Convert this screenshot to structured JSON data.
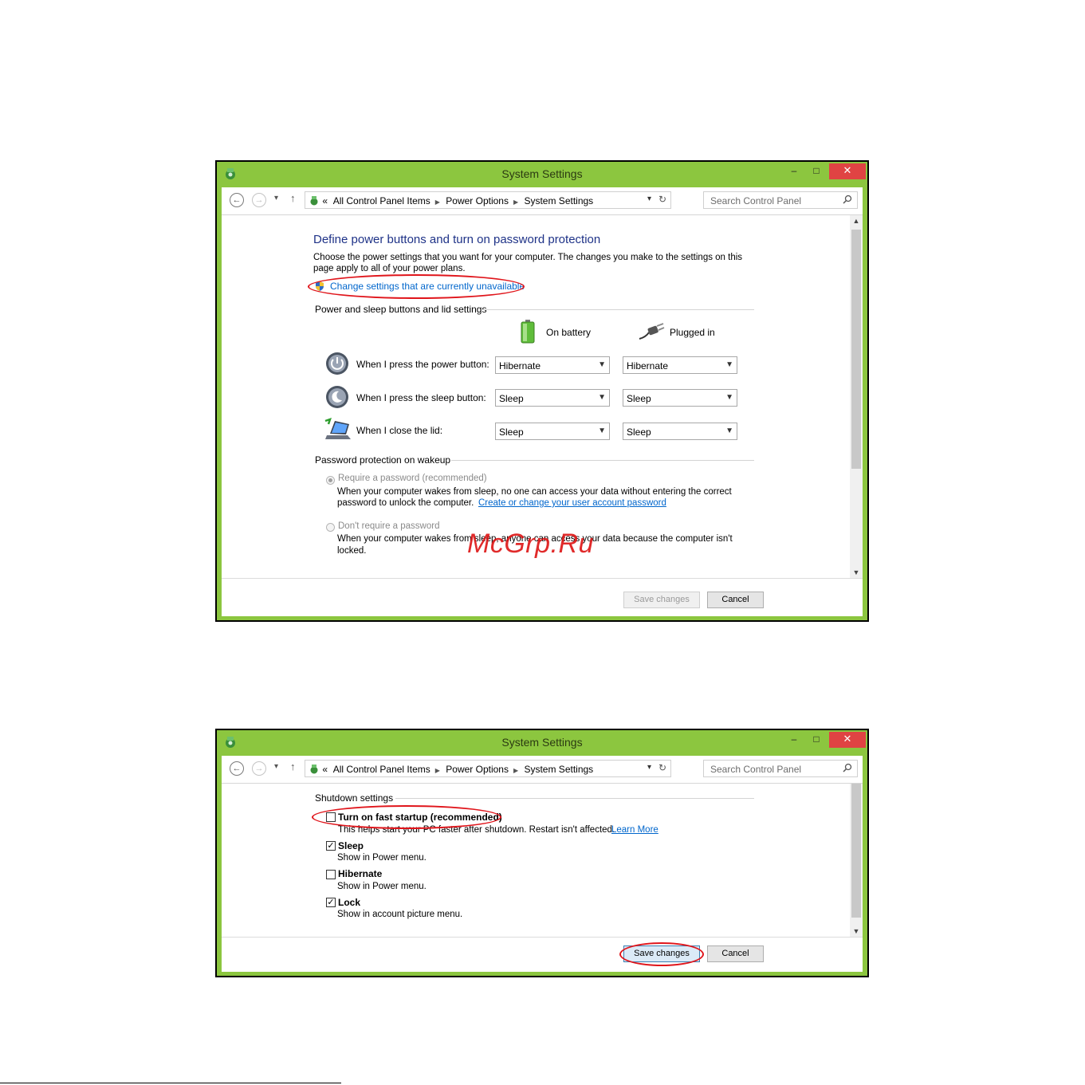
{
  "colors": {
    "frame": "#8cc63f",
    "close": "#e04343",
    "heading": "#1e3287",
    "link": "#0066cc",
    "annotation": "#e0151b"
  },
  "window1": {
    "title": "System Settings",
    "controls": {
      "minimize": "–",
      "maximize": "□",
      "close": "✕"
    },
    "nav": {
      "back": "←",
      "forward": "→",
      "recent": "▾",
      "up": "↑"
    },
    "address": {
      "prefix": "«",
      "crumbs": [
        "All Control Panel Items",
        "Power Options",
        "System Settings"
      ],
      "dropdown": "▾",
      "refresh": "↻"
    },
    "search": {
      "placeholder": "Search Control Panel"
    },
    "heading": "Define power buttons and turn on password protection",
    "intro_line1": "Choose the power settings that you want for your computer. The changes you make to the settings on this",
    "intro_line2": "page apply to all of your power plans.",
    "change_settings_link": "Change settings that are currently unavailable",
    "buttons_group": "Power and sleep buttons and lid settings",
    "col_battery": "On battery",
    "col_plugged": "Plugged in",
    "rows": [
      {
        "label": "When I press the power button:",
        "battery": "Hibernate",
        "plugged": "Hibernate",
        "icon": "power-button-icon"
      },
      {
        "label": "When I press the sleep button:",
        "battery": "Sleep",
        "plugged": "Sleep",
        "icon": "sleep-button-icon"
      },
      {
        "label": "When I close the lid:",
        "battery": "Sleep",
        "plugged": "Sleep",
        "icon": "laptop-lid-icon"
      }
    ],
    "password_group": "Password protection on wakeup",
    "require_label": "Require a password (recommended)",
    "require_desc1": "When your computer wakes from sleep, no one can access your data without entering the correct",
    "require_desc2": "password to unlock the computer.",
    "require_link": "Create or change your user account password",
    "norequire_label": "Don't require a password",
    "norequire_desc1": "When your computer wakes from sleep, anyone can access your data because the computer isn't",
    "norequire_desc2": "locked.",
    "save": "Save changes",
    "cancel": "Cancel"
  },
  "window2": {
    "title": "System Settings",
    "controls": {
      "minimize": "–",
      "maximize": "□",
      "close": "✕"
    },
    "nav": {
      "back": "←",
      "forward": "→",
      "recent": "▾",
      "up": "↑"
    },
    "address": {
      "prefix": "«",
      "crumbs": [
        "All Control Panel Items",
        "Power Options",
        "System Settings"
      ],
      "dropdown": "▾",
      "refresh": "↻"
    },
    "search": {
      "placeholder": "Search Control Panel"
    },
    "shutdown_group": "Shutdown settings",
    "options": [
      {
        "label": "Turn on fast startup (recommended)",
        "desc": "This helps start your PC faster after shutdown. Restart isn't affected.",
        "checked": false,
        "check_mark": ""
      },
      {
        "label": "Sleep",
        "desc": "Show in Power menu.",
        "checked": true,
        "check_mark": "✓"
      },
      {
        "label": "Hibernate",
        "desc": "Show in Power menu.",
        "checked": false,
        "check_mark": ""
      },
      {
        "label": "Lock",
        "desc": "Show in account picture menu.",
        "checked": true,
        "check_mark": "✓"
      }
    ],
    "learn_more": "Learn More",
    "save": "Save changes",
    "cancel": "Cancel"
  },
  "watermark": "McGrp.Ru"
}
